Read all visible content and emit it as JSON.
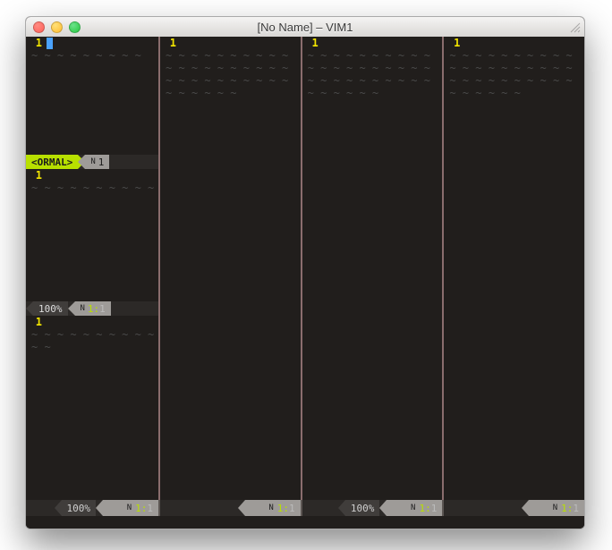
{
  "window": {
    "title": "[No Name] – VIM1"
  },
  "linenumber": "1",
  "tilde": "~",
  "panes": {
    "top_left": {
      "mode": "<ORMAL>",
      "buf_indicator": "N",
      "buf_num": "1"
    },
    "mid_left": {
      "percent": "100%",
      "buf_indicator": "N",
      "row": "1",
      "col": "1"
    }
  },
  "bottom": {
    "cells": [
      {
        "percent": "100%",
        "buf_indicator": "N",
        "row": "1",
        "col": "1"
      },
      {
        "percent": "",
        "buf_indicator": "N",
        "row": "1",
        "col": "1"
      },
      {
        "percent": "100%",
        "buf_indicator": "N",
        "row": "1",
        "col": "1"
      },
      {
        "percent": "",
        "buf_indicator": "N",
        "row": "1",
        "col": "1"
      }
    ]
  }
}
